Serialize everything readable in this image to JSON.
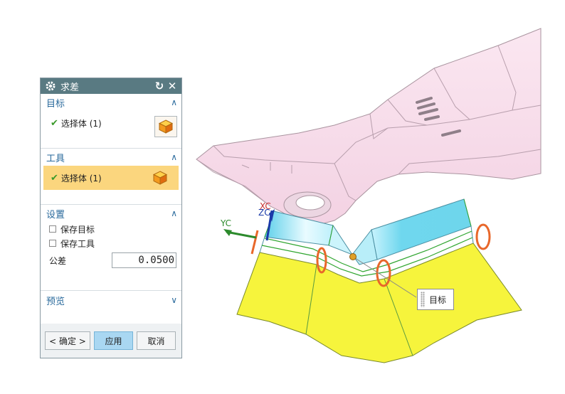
{
  "dialog": {
    "title": "求差",
    "reset_icon": "reset-icon",
    "close_icon": "close-icon",
    "sections": {
      "target": {
        "label": "目标",
        "select_label": "选择体 (1)",
        "expanded": true
      },
      "tool": {
        "label": "工具",
        "select_label": "选择体 (1)",
        "expanded": true,
        "active": true
      },
      "settings": {
        "label": "设置",
        "keep_target": {
          "label": "保存目标",
          "checked": false
        },
        "keep_tool": {
          "label": "保存工具",
          "checked": false
        },
        "tolerance_label": "公差",
        "tolerance_value": "0.0500"
      },
      "preview": {
        "label": "预览",
        "expanded": false
      }
    },
    "buttons": {
      "ok": "< 确定 >",
      "apply": "应用",
      "cancel": "取消"
    }
  },
  "viewport": {
    "axes": {
      "xc": "XC",
      "zc": "ZC",
      "yc": "YC"
    },
    "tooltip": "目标"
  },
  "colors": {
    "titlebar": "#597a82",
    "section_header": "#2a6a9c",
    "active_row": "#fbd67e",
    "apply_button": "#a9d7f2",
    "body_pink": "#f7dbe9",
    "tool_yellow": "#f6f43c",
    "cyan": "#6ed6ec"
  }
}
